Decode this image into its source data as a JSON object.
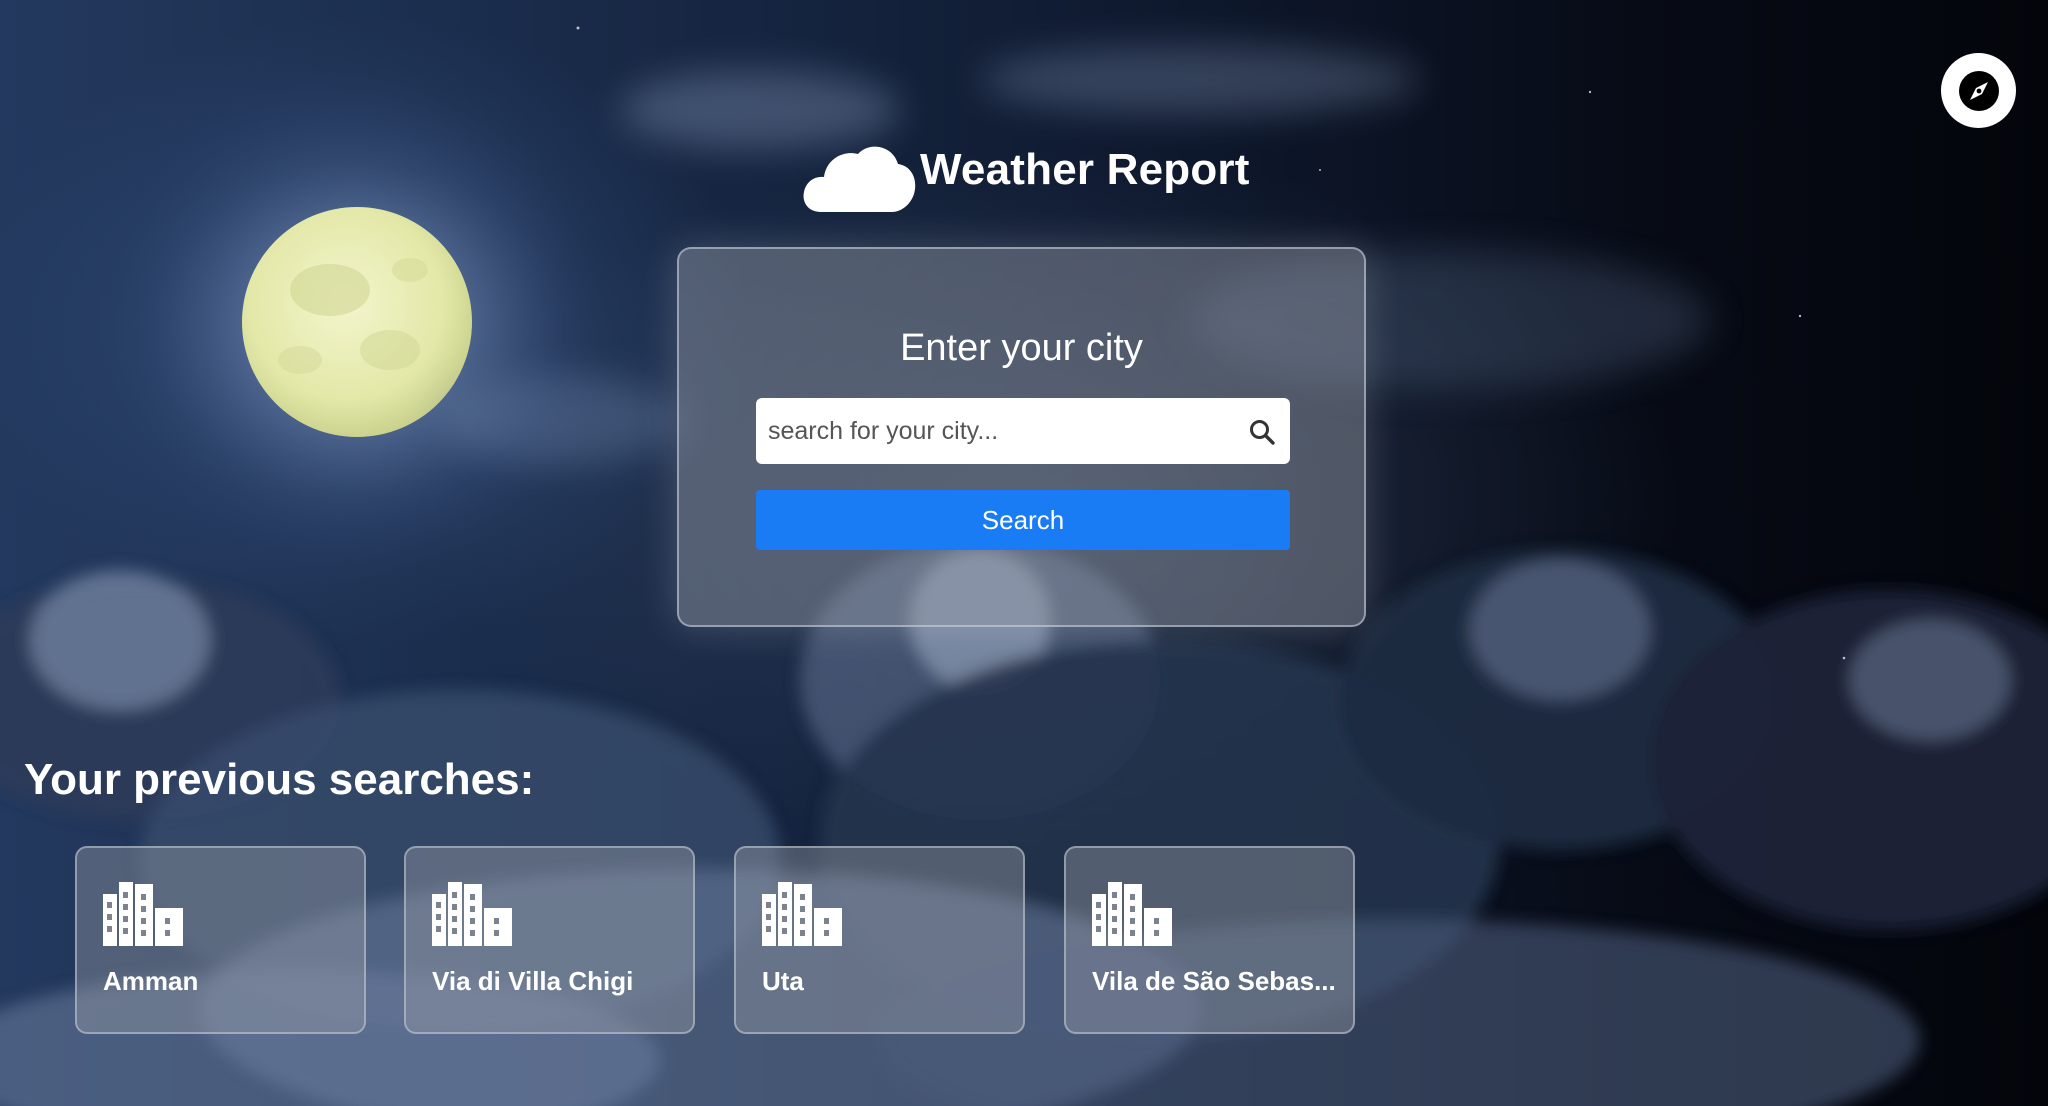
{
  "app": {
    "title": "Weather Report",
    "logo_icon": "cloud-icon"
  },
  "nav": {
    "compass_icon": "compass-icon"
  },
  "search": {
    "heading": "Enter your city",
    "placeholder": "search for your city...",
    "value": "",
    "icon": "search-icon",
    "button_label": "Search",
    "button_color": "#1a7cf5"
  },
  "previous": {
    "heading": "Your previous searches:",
    "items": [
      {
        "label": "Amman",
        "icon": "city-buildings-icon"
      },
      {
        "label": "Via di Villa Chigi",
        "icon": "city-buildings-icon"
      },
      {
        "label": "Uta",
        "icon": "city-buildings-icon"
      },
      {
        "label": "Vila de São Sebas...",
        "icon": "city-buildings-icon"
      }
    ]
  }
}
